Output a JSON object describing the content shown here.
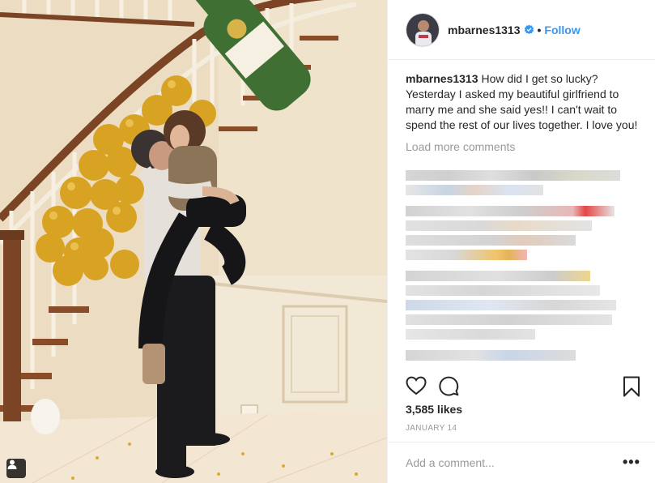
{
  "post": {
    "username": "mbarnes1313",
    "follow_label": "Follow",
    "separator": "•",
    "caption_user": "mbarnes1313",
    "caption_text": "How did I get so lucky? Yesterday I asked my beautiful girlfriend to marry me and she said yes!! I can't wait to spend the rest of our lives together. I love you!",
    "load_more": "Load more comments",
    "likes": "3,585 likes",
    "date": "January 14",
    "comment_placeholder": "Add a comment...",
    "more_label": "•••"
  },
  "colors": {
    "accent": "#3897f0",
    "text": "#262626",
    "muted": "#999999",
    "border": "#efefef"
  },
  "icons": {
    "verified": "verified-badge-icon",
    "like": "heart-icon",
    "comment": "comment-bubble-icon",
    "save": "bookmark-icon",
    "tags": "user-tag-icon",
    "options": "more-options-icon"
  }
}
